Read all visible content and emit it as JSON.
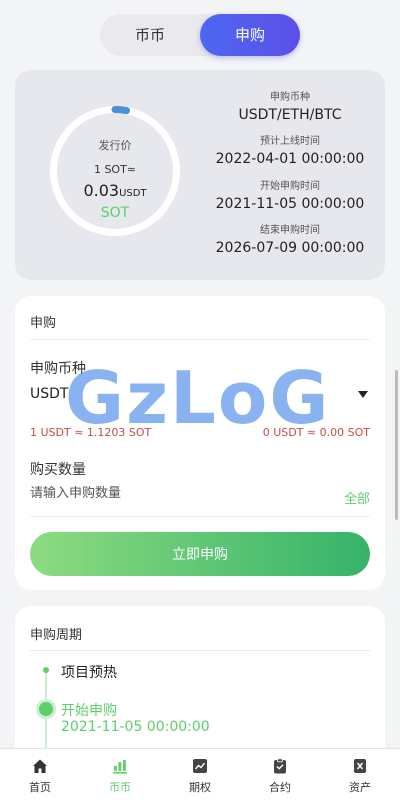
{
  "segment": {
    "left": "币币",
    "right": "申购"
  },
  "summary": {
    "ring_title": "发行价",
    "ring_rate": "1 SOT≈",
    "ring_price": "0.03",
    "ring_price_unit": "USDT",
    "ring_coin": "SOT",
    "ring_progress_fraction": 0.03,
    "items": [
      {
        "label": "申购币种",
        "value": "USDT/ETH/BTC"
      },
      {
        "label": "预计上线时间",
        "value": "2022-04-01 00:00:00"
      },
      {
        "label": "开始申购时间",
        "value": "2021-11-05 00:00:00"
      },
      {
        "label": "结束申购时间",
        "value": "2026-07-09 00:00:00"
      }
    ]
  },
  "form": {
    "title": "申购",
    "coin_label": "申购币种",
    "coin_value": "USDT",
    "rate_left": "1 USDT ≈ 1.1203 SOT",
    "rate_right": "0 USDT ≈ 0.00 SOT",
    "qty_label": "购买数量",
    "qty_placeholder": "请输入申购数量",
    "all_label": "全部",
    "submit": "立即申购"
  },
  "period": {
    "title": "申购周期",
    "steps": [
      {
        "name": "项目预热",
        "time": ""
      },
      {
        "name": "开始申购",
        "time": "2021-11-05 00:00:00"
      }
    ]
  },
  "watermark": "GzLoG",
  "nav": [
    "首页",
    "币币",
    "期权",
    "合约",
    "资产"
  ],
  "colors": {
    "accent_green": "#5dcf6b",
    "accent_blue": "#4c68f0",
    "rate_red": "#c94a4a"
  }
}
